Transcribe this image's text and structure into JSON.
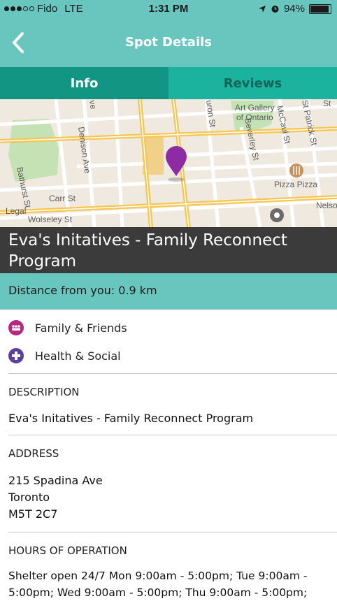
{
  "status_bar": {
    "carrier": "Fido",
    "network": "LTE",
    "time": "1:31 PM",
    "battery": "94%",
    "battery_level": 0.94
  },
  "nav": {
    "title": "Spot Details",
    "back_icon": "chevron-left-icon"
  },
  "tabs": [
    {
      "label": "Info",
      "active": true
    },
    {
      "label": "Reviews",
      "active": false
    }
  ],
  "map": {
    "labels": [
      "Art Gallery",
      "of Ontario",
      "McCaul St",
      "St Patrick St",
      "Denison Ave",
      "Beverley St",
      "Bathurst St",
      "Carr St",
      "Pizza Pizza",
      "Legal",
      "Wolseley St",
      "Nelson",
      "uron St",
      "ve",
      "St"
    ],
    "pin_color": "#8e2aa3"
  },
  "spot": {
    "title": "Eva's Initatives - Family Reconnect Program",
    "distance": "Distance from you: 0.9 km"
  },
  "categories": [
    {
      "label": "Family & Friends",
      "icon": "people-icon",
      "color": "#b5287f"
    },
    {
      "label": "Health & Social",
      "icon": "plus-icon",
      "color": "#5b3f9c"
    }
  ],
  "description": {
    "heading": "DESCRIPTION",
    "text": "Eva's Initatives - Family Reconnect Program"
  },
  "address": {
    "heading": "ADDRESS",
    "line1": "215 Spadina Ave",
    "line2": "Toronto",
    "line3": "M5T 2C7"
  },
  "hours": {
    "heading": "HOURS OF OPERATION",
    "line1": "Shelter open 24/7 Mon 9:00am - 5:00pm; Tue 9:00am -",
    "line2": "5:00pm; Wed 9:00am - 5:00pm; Thu 9:00am - 5:00pm;"
  }
}
